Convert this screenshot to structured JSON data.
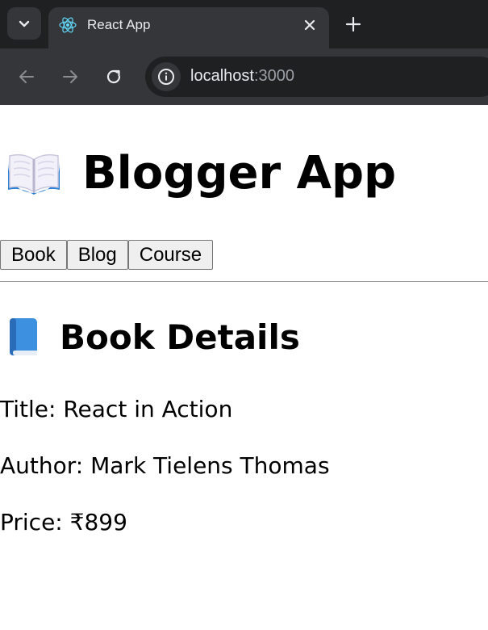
{
  "browser": {
    "tab": {
      "title": "React App",
      "favicon": "react-icon"
    },
    "address": {
      "host": "localhost",
      "port": ":3000"
    },
    "icons": {
      "tab_menu": "chevron-down-icon",
      "close": "close-icon",
      "new_tab": "plus-icon",
      "back": "back-arrow-icon",
      "forward": "forward-arrow-icon",
      "reload": "reload-icon",
      "site_info": "info-icon"
    }
  },
  "app": {
    "title": "Blogger App",
    "title_icon": "open-book-icon",
    "nav_buttons": [
      "Book",
      "Blog",
      "Course"
    ]
  },
  "section": {
    "title": "Book Details",
    "title_icon": "blue-book-icon",
    "fields": [
      "Title: React in Action",
      "Author: Mark Tielens Thomas",
      "Price: ₹899"
    ]
  },
  "colors": {
    "chrome_dark": "#1f2022",
    "chrome_tab": "#35363a",
    "chrome_text": "#e8eaed",
    "react_blue": "#61dafb",
    "button_bg": "#efefef"
  }
}
